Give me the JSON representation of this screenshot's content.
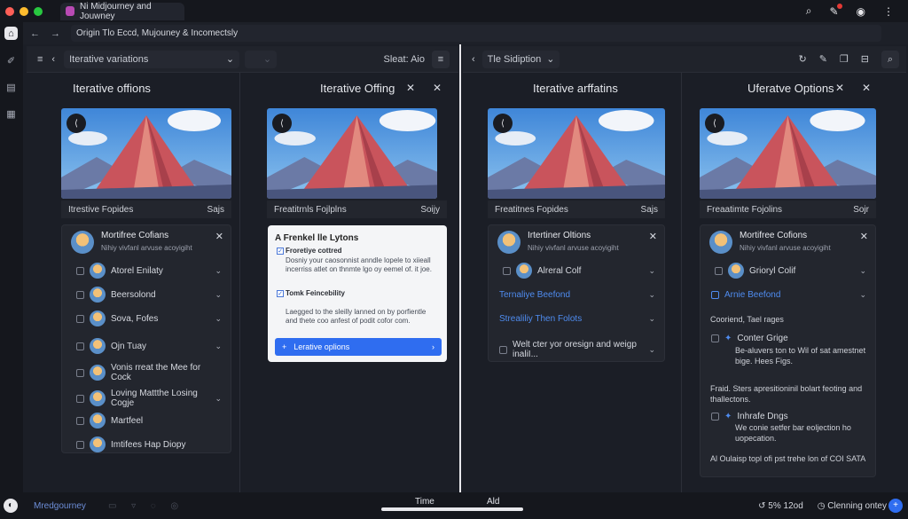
{
  "browser": {
    "tab_title": "Ni Midjourney and Jouwney",
    "address": "Origin Tlo Eccd, Mujouney & Incomectsly"
  },
  "left_toolbar": {
    "select_label": "Iterative variations",
    "sort_label": "Sleat: Aio"
  },
  "right_toolbar": {
    "select_label": "Tle Sidiption"
  },
  "columns": [
    {
      "title": "Iterative offions",
      "caption_left": "Itrestive Fopides",
      "caption_right": "Sajs",
      "card": {
        "head_title": "Mortifree Cofians",
        "head_sub": "Nihiy vivfanl arvuse acoyigiht",
        "rows": [
          "Atorel Enilaty",
          "Beersolond",
          "Sova, Fofes",
          "Ojn Tuay",
          "Vonis rreat the Mee for Cock",
          "Loving Mattthe Losing Cogje",
          "Martfeel",
          "Imtifees Hap Diopy"
        ]
      }
    },
    {
      "title": "Iterative Offing",
      "caption_left": "Freatitrnls Fojlplns",
      "caption_right": "Soijy",
      "popup": {
        "heading": "A Frenkel lle Lytons",
        "check1_label": "Froretiye cottred",
        "check1_text": "Dosniy your caosonnist anndle lopele to xiieall incerriss atlet on thnmte lgo oy eemel of. it joe.",
        "check2_label": "Tomk Feincebility",
        "check2_text": "Laegged to the sleilly lanned on by porfientle and thete coo anfest of podit cofor com.",
        "button": "Lerative oplions"
      }
    },
    {
      "title": "Iterative arffatins",
      "caption_left": "Freatitnes Fopides",
      "caption_right": "Sajs",
      "card": {
        "head_title": "Irtertiner Oltions",
        "head_sub": "Nihiy vivfanl arvuse acoyigiht",
        "rows": [
          "Alreral Colf",
          "Ternaliye Beefond",
          "Strealiliy Then Folots",
          "Welt cter yor oresign and weigp inaliI..."
        ]
      }
    },
    {
      "title": "Uferatve Options",
      "caption_left": "Freaatimte Fojolins",
      "caption_right": "Sojr",
      "card": {
        "head_title": "Mortifree Cofions",
        "head_sub": "Nihiy vivfanl arvuse acoyigiht",
        "rows": [
          "Grioryl Colif",
          "Arnie Beefond"
        ],
        "section_label": "Cooriend, Tael rages",
        "opt1_title": "Conter Grige",
        "opt1_text": "Be-aluvers ton to Wil of sat amestnet bige. Hees Figs.",
        "para": "Fraid. Sters apresitioninil bolart feoting and thallectons.",
        "opt2_title": "Inhrafe Dngs",
        "opt2_text": "We conie setfer bar eoljection ho uopecation.",
        "footer": "Al Oulaisp topl ofi pst trehe lon of COI SATA"
      }
    }
  ],
  "bottom": {
    "left_label": "Mredgourney",
    "center_1": "Time",
    "center_2": "Ald",
    "right_1": "5% 12od",
    "right_2": "Clenning ontey"
  },
  "colors": {
    "accent": "#2f6df0",
    "background": "#1b1e26"
  }
}
